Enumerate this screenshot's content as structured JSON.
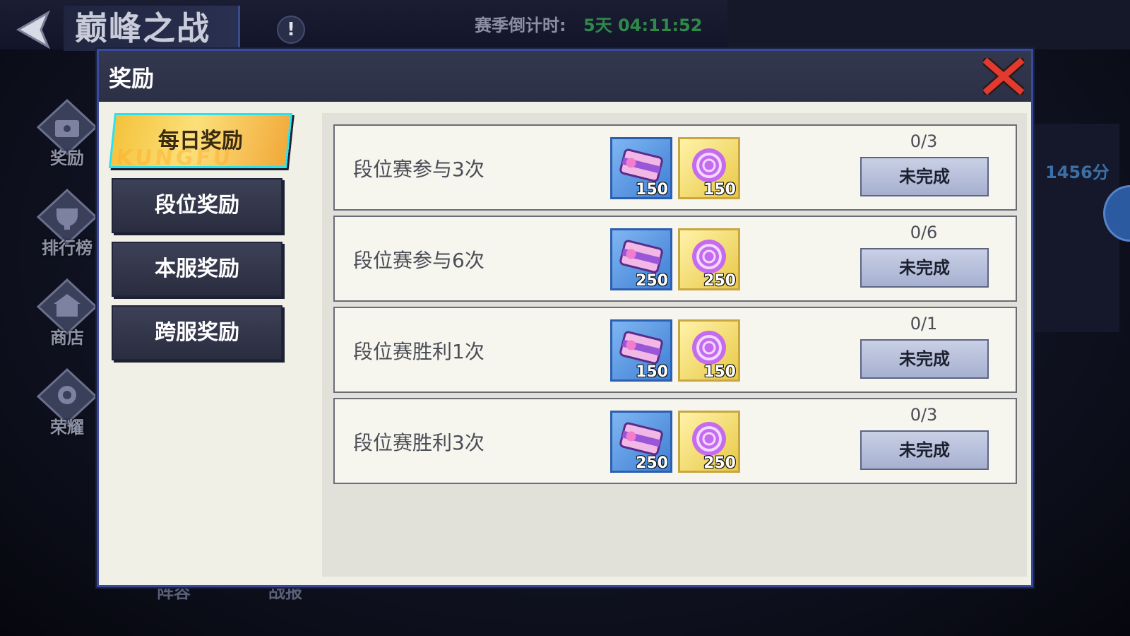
{
  "header": {
    "title": "巅峰之战",
    "info_glyph": "!",
    "season_label": "赛季倒计时:",
    "season_countdown": "5天 04:11:52"
  },
  "side_nav": [
    {
      "label": "奖励",
      "icon": "treasure-chest-icon"
    },
    {
      "label": "排行榜",
      "icon": "trophy-icon"
    },
    {
      "label": "商店",
      "icon": "shop-icon"
    },
    {
      "label": "荣耀",
      "icon": "medal-icon"
    }
  ],
  "score": "1456分",
  "bottom_tabs": [
    "阵容",
    "战报"
  ],
  "modal": {
    "title": "奖励",
    "tabs": [
      {
        "label": "每日奖励",
        "active": true,
        "watermark": "KUNGFU"
      },
      {
        "label": "段位奖励",
        "active": false
      },
      {
        "label": "本服奖励",
        "active": false
      },
      {
        "label": "跨服奖励",
        "active": false
      }
    ],
    "tasks": [
      {
        "name": "段位赛参与3次",
        "rewards": [
          {
            "type": "ticket",
            "qty": "150"
          },
          {
            "type": "orb",
            "qty": "150"
          }
        ],
        "progress": "0/3",
        "status": "未完成"
      },
      {
        "name": "段位赛参与6次",
        "rewards": [
          {
            "type": "ticket",
            "qty": "250"
          },
          {
            "type": "orb",
            "qty": "250"
          }
        ],
        "progress": "0/6",
        "status": "未完成"
      },
      {
        "name": "段位赛胜利1次",
        "rewards": [
          {
            "type": "ticket",
            "qty": "150"
          },
          {
            "type": "orb",
            "qty": "150"
          }
        ],
        "progress": "0/1",
        "status": "未完成"
      },
      {
        "name": "段位赛胜利3次",
        "rewards": [
          {
            "type": "ticket",
            "qty": "250"
          },
          {
            "type": "orb",
            "qty": "250"
          }
        ],
        "progress": "0/3",
        "status": "未完成"
      }
    ]
  },
  "colors": {
    "modal_border": "#3a4a9a",
    "active_tab": "#f4c23b",
    "countdown": "#2f8a4a",
    "status_button": "#b5bedb"
  }
}
